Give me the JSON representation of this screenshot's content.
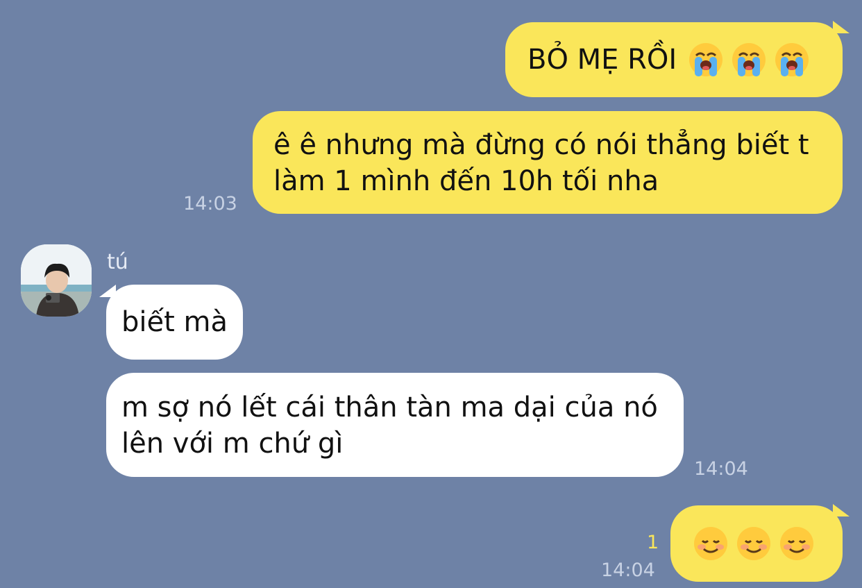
{
  "messages": {
    "m1": {
      "text": "BỎ MẸ RỒI",
      "emojis": [
        "loudly-crying-face-icon",
        "loudly-crying-face-icon",
        "loudly-crying-face-icon"
      ]
    },
    "m2": {
      "text": "ê ê nhưng mà đừng có nói thẳng biết t\nlàm 1 mình đến 10h tối nha",
      "time": "14:03"
    },
    "m3": {
      "sender": "tú",
      "text": "biết mà"
    },
    "m4": {
      "text": "m sợ nó lết cái thân tàn ma dại của nó\nlên với m chứ gì",
      "time": "14:04"
    },
    "m5": {
      "emojis": [
        "smiling-face-icon",
        "smiling-face-icon",
        "smiling-face-icon"
      ],
      "unread": "1",
      "time": "14:04"
    }
  },
  "colors": {
    "background": "#6e82a6",
    "outgoing_bubble": "#fae65a",
    "incoming_bubble": "#ffffff",
    "timestamp": "#c8d2e4",
    "unread_count": "#fae65a"
  }
}
